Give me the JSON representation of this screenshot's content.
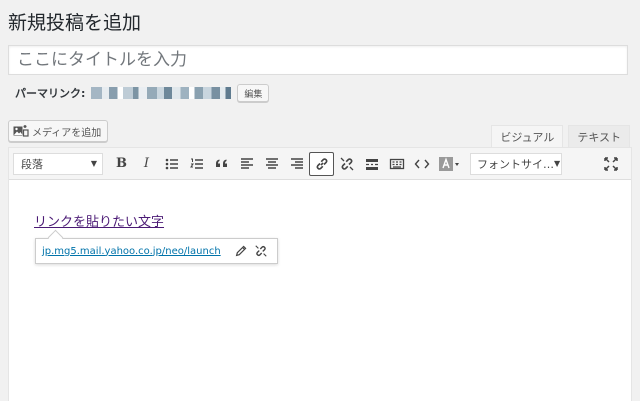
{
  "page": {
    "title": "新規投稿を追加"
  },
  "post_title": {
    "placeholder": "ここにタイトルを入力",
    "value": ""
  },
  "permalink": {
    "label": "パーマリンク:",
    "edit_label": "編集"
  },
  "media": {
    "add_label": "メディアを追加"
  },
  "tabs": [
    {
      "label": "ビジュアル",
      "active": true
    },
    {
      "label": "テキスト",
      "active": false
    }
  ],
  "toolbar": {
    "format_select": "段落",
    "bold": "B",
    "italic": "I",
    "font_select": "フォントサイ…",
    "icons": [
      "unordered-list-icon",
      "ordered-list-icon",
      "blockquote-icon",
      "align-left-icon",
      "align-center-icon",
      "align-right-icon",
      "link-icon",
      "unlink-icon",
      "read-more-icon",
      "toolbar-toggle-icon",
      "code-icon",
      "text-color-icon",
      "fullscreen-icon"
    ]
  },
  "content": {
    "linked_text": "リンクを貼りたい文字",
    "link_url": "jp.mg5.mail.yahoo.co.jp/neo/launch"
  },
  "colors": {
    "link": "#0073aa",
    "visited_link": "#4b1a75",
    "background": "#f1f1f1"
  }
}
